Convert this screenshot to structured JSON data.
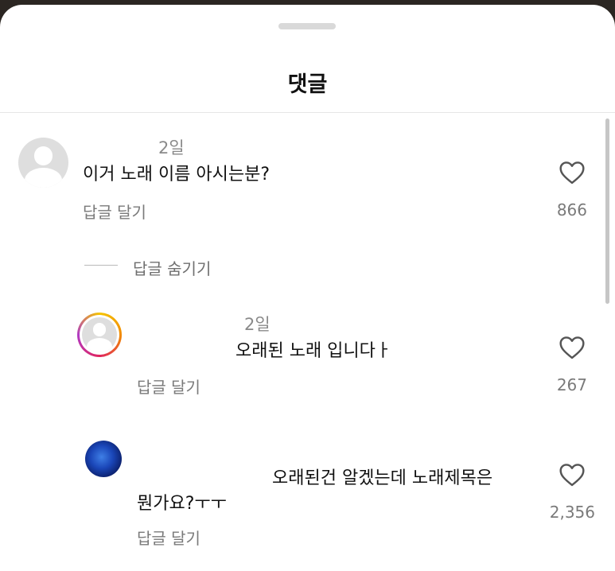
{
  "sheet": {
    "title": "댓글"
  },
  "comments": [
    {
      "time": "2일",
      "text": "이거 노래 이름 아시는분?",
      "reply_label": "답글 달기",
      "like_count": "866"
    }
  ],
  "thread": {
    "hide_replies_label": "답글 숨기기"
  },
  "replies": [
    {
      "time": "2일",
      "text": "오래된 노래 입니다ㅏ",
      "reply_label": "답글 달기",
      "like_count": "267"
    },
    {
      "text_line1": "오래된건 알겠는데 노래제목은",
      "text_line2": "뭔가요?ㅜㅜ",
      "reply_label": "답글 달기",
      "like_count": "2,356"
    }
  ],
  "icons": {
    "heart": "heart-outline-icon",
    "avatar": "default-profile-avatar"
  },
  "colors": {
    "text": "#111111",
    "secondary": "#8a8a8a",
    "avatar_gray": "#dedede"
  }
}
